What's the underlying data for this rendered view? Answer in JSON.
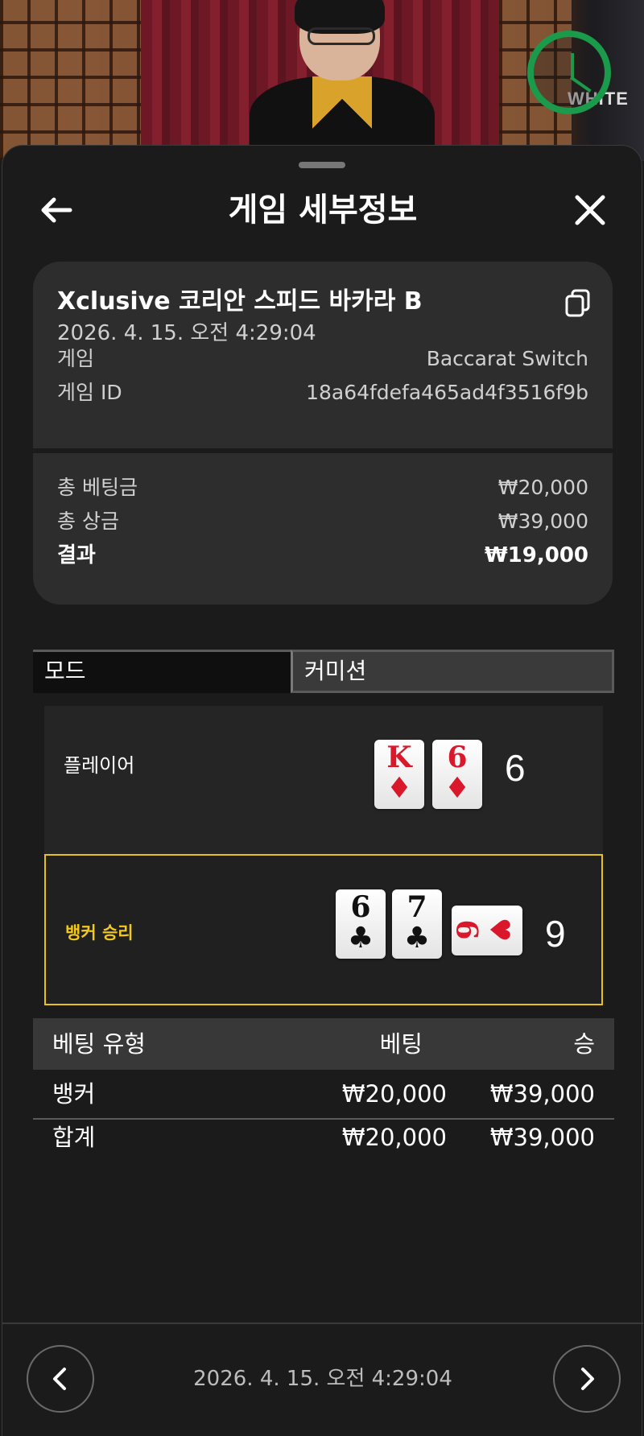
{
  "video": {
    "brand_text": "WHITE"
  },
  "header": {
    "title": "게임 세부정보"
  },
  "summary": {
    "game_name": "Xclusive 코리안 스피드 바카라 B",
    "datetime": "2026. 4. 15. 오전 4:29:04",
    "game_label": "게임",
    "game_value": "Baccarat Switch",
    "game_id_label": "게임 ID",
    "game_id_value": "18a64fdefa465ad4f3516f9b",
    "total_bet_label": "총 베팅금",
    "total_bet_value": "₩20,000",
    "total_prize_label": "총 상금",
    "total_prize_value": "₩39,000",
    "result_label": "결과",
    "result_value": "₩19,000"
  },
  "tabs": [
    {
      "label": "모드",
      "active": true
    },
    {
      "label": "커미션",
      "active": false
    }
  ],
  "player": {
    "label": "플레이어",
    "total": "6",
    "cards": [
      {
        "rank": "K",
        "suit": "♦",
        "color": "red"
      },
      {
        "rank": "6",
        "suit": "♦",
        "color": "red"
      }
    ]
  },
  "banker": {
    "label": "뱅커 승리",
    "total": "9",
    "cards": [
      {
        "rank": "6",
        "suit": "♣",
        "color": "black"
      },
      {
        "rank": "7",
        "suit": "♣",
        "color": "black"
      }
    ],
    "third_card": {
      "rank": "6",
      "suit": "♥",
      "color": "red",
      "orientation": "sideways"
    },
    "highlight_color": "#e8c21a"
  },
  "bets": {
    "headers": [
      "베팅 유형",
      "베팅",
      "승"
    ],
    "rows": [
      {
        "type": "뱅커",
        "bet": "₩20,000",
        "win": "₩39,000"
      }
    ],
    "total": {
      "type": "합계",
      "bet": "₩20,000",
      "win": "₩39,000"
    }
  },
  "footer": {
    "datetime": "2026. 4. 15. 오전 4:29:04",
    "prev_icon": "chevron-left-icon",
    "next_icon": "chevron-right-icon"
  },
  "colors": {
    "background": "#1b1b1b",
    "card": "#2d2d2d",
    "winner_highlight": "#e8c21a",
    "timer": "#1a9a4a"
  }
}
